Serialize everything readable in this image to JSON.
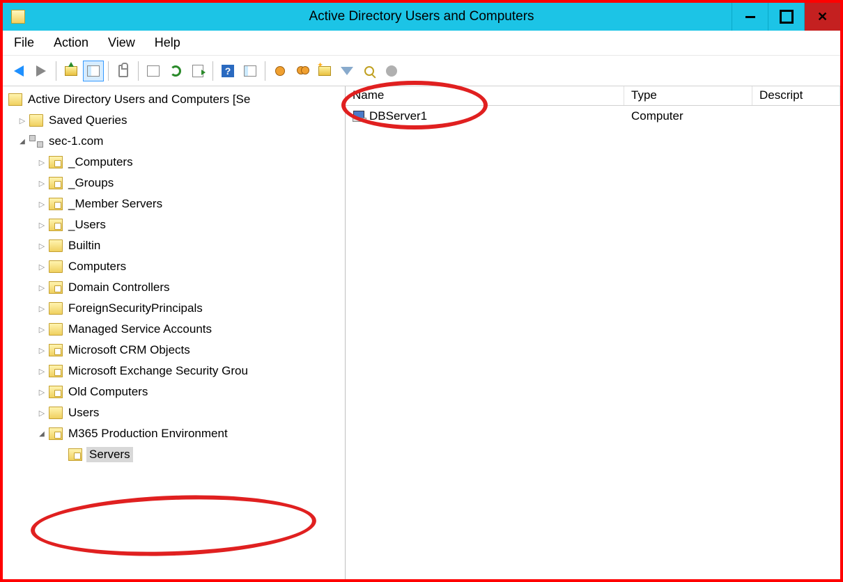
{
  "window": {
    "title": "Active Directory Users and Computers"
  },
  "menu": {
    "file": "File",
    "action": "Action",
    "view": "View",
    "help": "Help"
  },
  "tree": {
    "root": "Active Directory Users and Computers [Se",
    "saved_queries": "Saved Queries",
    "domain": "sec-1.com",
    "ou": [
      "_Computers",
      "_Groups",
      "_Member Servers",
      "_Users",
      "Builtin",
      "Computers",
      "Domain Controllers",
      "ForeignSecurityPrincipals",
      "Managed Service Accounts",
      "Microsoft CRM Objects",
      "Microsoft Exchange Security Grou",
      "Old Computers",
      "Users",
      "M365 Production Environment"
    ],
    "servers": "Servers"
  },
  "columns": {
    "name": "Name",
    "type": "Type",
    "desc": "Descript"
  },
  "rows": [
    {
      "name": "DBServer1",
      "type": "Computer",
      "desc": ""
    }
  ]
}
